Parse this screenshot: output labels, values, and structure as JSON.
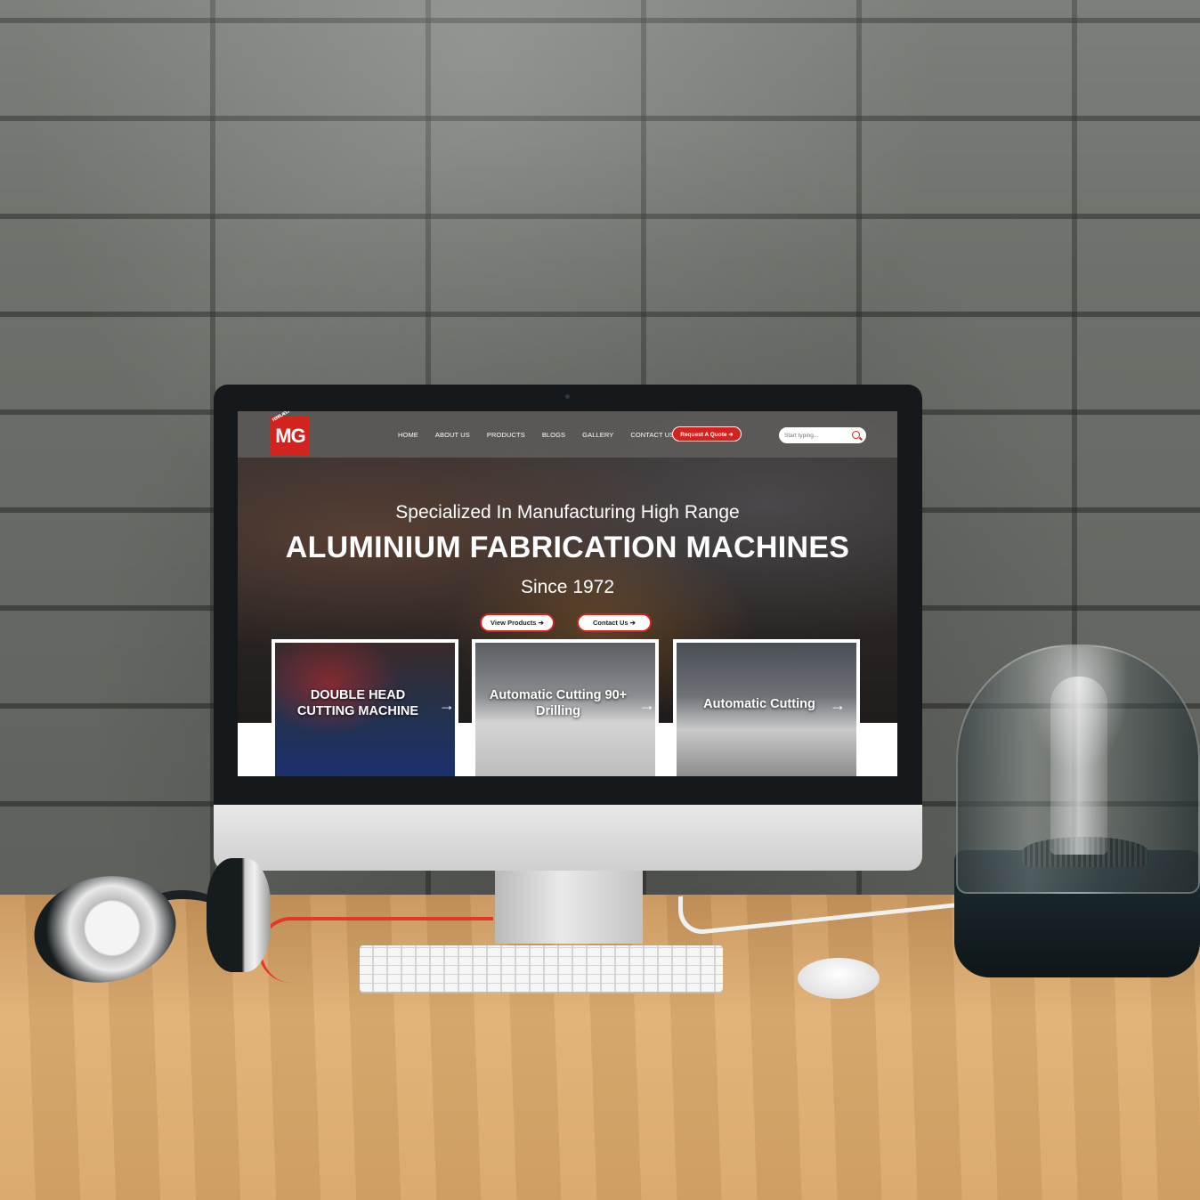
{
  "brand": {
    "logo_text": "MG",
    "logo_small": "PERFILADORAS"
  },
  "nav": {
    "items": [
      {
        "label": "HOME"
      },
      {
        "label": "ABOUT US"
      },
      {
        "label": "PRODUCTS"
      },
      {
        "label": "BLOGS"
      },
      {
        "label": "GALLERY"
      },
      {
        "label": "CONTACT US"
      }
    ],
    "quote_button": "Request A Quote ➔"
  },
  "search": {
    "placeholder": "Start typing..."
  },
  "hero": {
    "subtitle": "Specialized In Manufacturing High Range",
    "title": "ALUMINIUM FABRICATION MACHINES",
    "since": "Since 1972",
    "buttons": [
      {
        "label": "View Products ➔"
      },
      {
        "label": "Contact Us ➔"
      }
    ]
  },
  "cards": [
    {
      "label": "DOUBLE HEAD CUTTING MACHINE",
      "icon": "arrow-right-icon"
    },
    {
      "label": "Automatic Cutting 90+ Drilling",
      "icon": "arrow-right-icon"
    },
    {
      "label": "Automatic Cutting",
      "icon": "arrow-right-icon"
    }
  ],
  "colors": {
    "accent": "#d2231f",
    "nav_bg": "#5f5c5a",
    "hero_bg": "#2b2625"
  }
}
